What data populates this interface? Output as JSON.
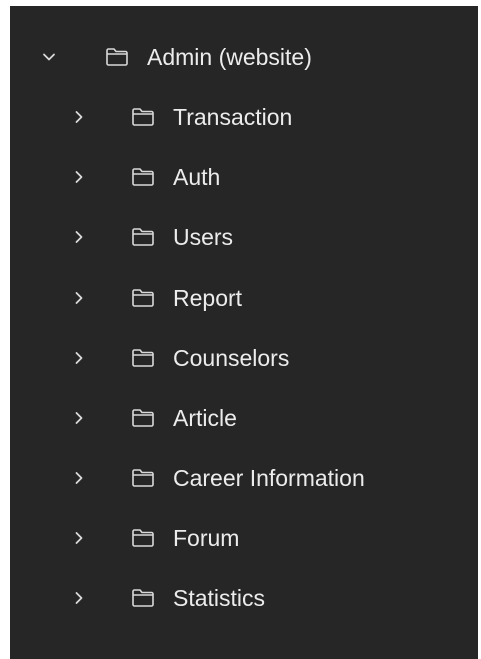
{
  "colors": {
    "panel_background": "#262626",
    "text": "#ececec",
    "icon": "#d9d9d9"
  },
  "icons": {
    "expanded": "chevron-down-icon",
    "collapsed": "chevron-right-icon",
    "folder": "folder-icon"
  },
  "tree": {
    "root": {
      "label": "Admin (website)",
      "expanded": true
    },
    "children": [
      {
        "label": "Transaction",
        "expanded": false
      },
      {
        "label": "Auth",
        "expanded": false
      },
      {
        "label": "Users",
        "expanded": false
      },
      {
        "label": "Report",
        "expanded": false
      },
      {
        "label": "Counselors",
        "expanded": false
      },
      {
        "label": "Article",
        "expanded": false
      },
      {
        "label": "Career Information",
        "expanded": false
      },
      {
        "label": "Forum",
        "expanded": false
      },
      {
        "label": "Statistics",
        "expanded": false
      }
    ]
  }
}
